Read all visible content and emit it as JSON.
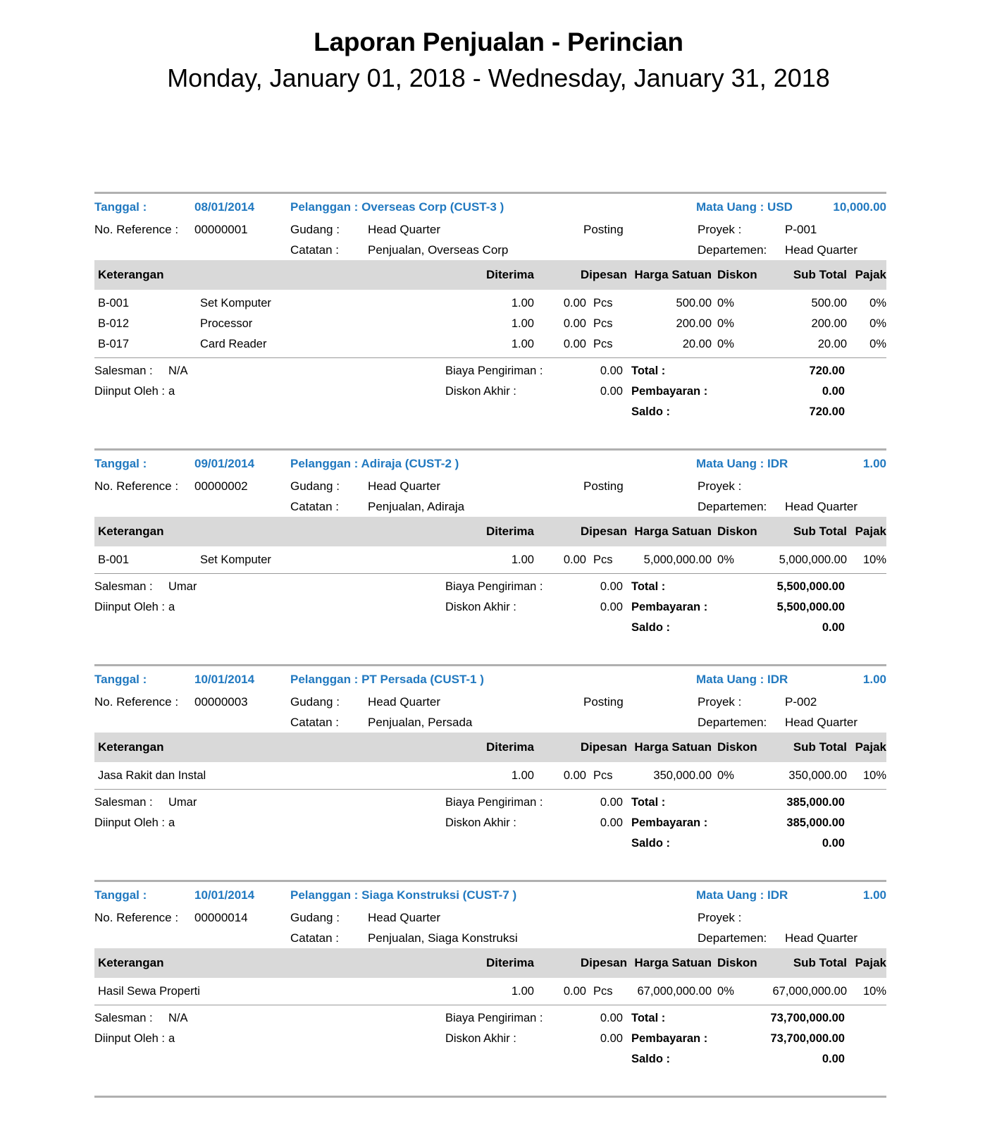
{
  "document": {
    "title": "Laporan Penjualan - Perincian",
    "subtitle": "Monday, January 01, 2018 - Wednesday, January 31, 2018"
  },
  "labels": {
    "tanggal": "Tanggal :",
    "no_reference": "No. Reference :",
    "pelanggan": "Pelanggan :",
    "gudang": "Gudang :",
    "catatan": "Catatan :",
    "mata_uang": "Mata Uang :",
    "proyek": "Proyek :",
    "departemen": "Departemen:",
    "salesman": "Salesman :",
    "diinput_oleh": "Diinput Oleh :",
    "biaya_pengiriman": "Biaya Pengiriman :",
    "diskon_akhir": "Diskon Akhir :",
    "total": "Total :",
    "pembayaran": "Pembayaran :",
    "saldo": "Saldo :"
  },
  "table_headers": {
    "keterangan": "Keterangan",
    "diterima": "Diterima",
    "dipesan": "Dipesan",
    "harga_satuan": "Harga Satuan",
    "diskon": "Diskon",
    "sub_total": "Sub Total",
    "pajak": "Pajak"
  },
  "colors": {
    "accent_blue": "#2179c0",
    "header_gray": "#d9d9d9",
    "rule_gray": "#b0b0b0"
  },
  "records": [
    {
      "tanggal": "08/01/2014",
      "pelanggan": "Pelanggan : Overseas Corp (CUST-3 )",
      "mata_uang": "Mata Uang : USD",
      "kurs": "10,000.00",
      "no_reference": "00000001",
      "gudang": "Head Quarter",
      "posting": "Posting",
      "proyek": "P-001",
      "catatan": "Penjualan, Overseas Corp",
      "departemen": "Head Quarter",
      "items": [
        {
          "code": "B-001",
          "desc": "Set Komputer",
          "diterima": "1.00",
          "dipesan": "0.00",
          "unit": "Pcs",
          "harga": "500.00",
          "diskon": "0%",
          "subtotal": "500.00",
          "pajak": "0%"
        },
        {
          "code": "B-012",
          "desc": "Processor",
          "diterima": "1.00",
          "dipesan": "0.00",
          "unit": "Pcs",
          "harga": "200.00",
          "diskon": "0%",
          "subtotal": "200.00",
          "pajak": "0%"
        },
        {
          "code": "B-017",
          "desc": "Card Reader",
          "diterima": "1.00",
          "dipesan": "0.00",
          "unit": "Pcs",
          "harga": "20.00",
          "diskon": "0%",
          "subtotal": "20.00",
          "pajak": "0%"
        }
      ],
      "salesman": "N/A",
      "diinput_oleh": "a",
      "biaya_pengiriman": "0.00",
      "diskon_akhir": "0.00",
      "total": "720.00",
      "pembayaran": "0.00",
      "saldo": "720.00"
    },
    {
      "tanggal": "09/01/2014",
      "pelanggan": "Pelanggan : Adiraja (CUST-2 )",
      "mata_uang": "Mata Uang : IDR",
      "kurs": "1.00",
      "no_reference": "00000002",
      "gudang": "Head Quarter",
      "posting": "Posting",
      "proyek": "",
      "catatan": "Penjualan, Adiraja",
      "departemen": "Head Quarter",
      "items": [
        {
          "code": "B-001",
          "desc": "Set Komputer",
          "diterima": "1.00",
          "dipesan": "0.00",
          "unit": "Pcs",
          "harga": "5,000,000.00",
          "diskon": "0%",
          "subtotal": "5,000,000.00",
          "pajak": "10%"
        }
      ],
      "salesman": "Umar",
      "diinput_oleh": "a",
      "biaya_pengiriman": "0.00",
      "diskon_akhir": "0.00",
      "total": "5,500,000.00",
      "pembayaran": "5,500,000.00",
      "saldo": "0.00"
    },
    {
      "tanggal": "10/01/2014",
      "pelanggan": "Pelanggan : PT Persada (CUST-1 )",
      "mata_uang": "Mata Uang : IDR",
      "kurs": "1.00",
      "no_reference": "00000003",
      "gudang": "Head Quarter",
      "posting": "Posting",
      "proyek": "P-002",
      "catatan": "Penjualan, Persada",
      "departemen": "Head Quarter",
      "items": [
        {
          "code": "Jasa Rakit dan Instal",
          "desc": "",
          "diterima": "1.00",
          "dipesan": "0.00",
          "unit": "Pcs",
          "harga": "350,000.00",
          "diskon": "0%",
          "subtotal": "350,000.00",
          "pajak": "10%"
        }
      ],
      "salesman": "Umar",
      "diinput_oleh": "a",
      "biaya_pengiriman": "0.00",
      "diskon_akhir": "0.00",
      "total": "385,000.00",
      "pembayaran": "385,000.00",
      "saldo": "0.00"
    },
    {
      "tanggal": "10/01/2014",
      "pelanggan": "Pelanggan : Siaga Konstruksi (CUST-7 )",
      "mata_uang": "Mata Uang : IDR",
      "kurs": "1.00",
      "no_reference": "00000014",
      "gudang": "Head Quarter",
      "posting": "",
      "proyek": "",
      "catatan": "Penjualan, Siaga Konstruksi",
      "departemen": "Head Quarter",
      "items": [
        {
          "code": "Hasil Sewa Properti",
          "desc": "",
          "diterima": "1.00",
          "dipesan": "0.00",
          "unit": "Pcs",
          "harga": "67,000,000.00",
          "diskon": "0%",
          "subtotal": "67,000,000.00",
          "pajak": "10%"
        }
      ],
      "salesman": "N/A",
      "diinput_oleh": "a",
      "biaya_pengiriman": "0.00",
      "diskon_akhir": "0.00",
      "total": "73,700,000.00",
      "pembayaran": "73,700,000.00",
      "saldo": "0.00"
    }
  ]
}
